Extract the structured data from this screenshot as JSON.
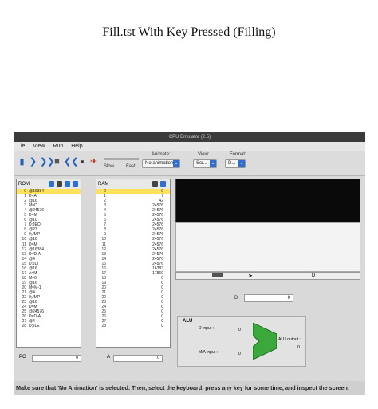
{
  "page": {
    "title": "Fill.tst With Key Pressed (Filling)"
  },
  "window": {
    "title": "CPU Emulator (2.5)"
  },
  "menu": [
    "le",
    "View",
    "Run",
    "Help"
  ],
  "toolbar": {
    "slow_label": "Slow",
    "fast_label": "Fast",
    "animate_label": "Animate:",
    "animate_value": "No animation",
    "view_label": "View:",
    "view_value": "Scr...",
    "format_label": "Format:",
    "format_value": "D..."
  },
  "rom": {
    "title": "ROM",
    "rows": [
      {
        "a": "0",
        "v": "@16384"
      },
      {
        "a": "1",
        "v": "D=A"
      },
      {
        "a": "2",
        "v": "@16"
      },
      {
        "a": "3",
        "v": "M=D"
      },
      {
        "a": "4",
        "v": "@24576"
      },
      {
        "a": "5",
        "v": "D=M"
      },
      {
        "a": "6",
        "v": "@10"
      },
      {
        "a": "7",
        "v": "D;JEQ"
      },
      {
        "a": "8",
        "v": "@23"
      },
      {
        "a": "9",
        "v": "0;JMP"
      },
      {
        "a": "10",
        "v": "@16"
      },
      {
        "a": "11",
        "v": "D=M"
      },
      {
        "a": "12",
        "v": "@16384"
      },
      {
        "a": "13",
        "v": "D=D-A"
      },
      {
        "a": "14",
        "v": "@4"
      },
      {
        "a": "15",
        "v": "D;JLT"
      },
      {
        "a": "16",
        "v": "@16"
      },
      {
        "a": "17",
        "v": "A=M"
      },
      {
        "a": "18",
        "v": "M=0"
      },
      {
        "a": "19",
        "v": "@16"
      },
      {
        "a": "20",
        "v": "M=M-1"
      },
      {
        "a": "21",
        "v": "@4"
      },
      {
        "a": "22",
        "v": "0;JMP"
      },
      {
        "a": "23",
        "v": "@16"
      },
      {
        "a": "24",
        "v": "D=M"
      },
      {
        "a": "25",
        "v": "@24576"
      },
      {
        "a": "26",
        "v": "D=D-A"
      },
      {
        "a": "27",
        "v": "@4"
      },
      {
        "a": "28",
        "v": "D;JLE"
      }
    ],
    "pc_label": "PC",
    "pc_value": "0"
  },
  "ram": {
    "title": "RAM",
    "rows": [
      {
        "a": "0",
        "v": "0"
      },
      {
        "a": "1",
        "v": "7"
      },
      {
        "a": "2",
        "v": "42"
      },
      {
        "a": "3",
        "v": "24576"
      },
      {
        "a": "4",
        "v": "24576"
      },
      {
        "a": "5",
        "v": "24576"
      },
      {
        "a": "6",
        "v": "24576"
      },
      {
        "a": "7",
        "v": "24576"
      },
      {
        "a": "8",
        "v": "24576"
      },
      {
        "a": "9",
        "v": "24576"
      },
      {
        "a": "10",
        "v": "24576"
      },
      {
        "a": "11",
        "v": "24576"
      },
      {
        "a": "12",
        "v": "24576"
      },
      {
        "a": "13",
        "v": "24576"
      },
      {
        "a": "14",
        "v": "24576"
      },
      {
        "a": "15",
        "v": "24576"
      },
      {
        "a": "16",
        "v": "16383"
      },
      {
        "a": "17",
        "v": "17860"
      },
      {
        "a": "18",
        "v": "0"
      },
      {
        "a": "19",
        "v": "0"
      },
      {
        "a": "20",
        "v": "0"
      },
      {
        "a": "21",
        "v": "0"
      },
      {
        "a": "22",
        "v": "0"
      },
      {
        "a": "23",
        "v": "0"
      },
      {
        "a": "24",
        "v": "0"
      },
      {
        "a": "25",
        "v": "0"
      },
      {
        "a": "26",
        "v": "0"
      },
      {
        "a": "27",
        "v": "0"
      },
      {
        "a": "28",
        "v": "0"
      }
    ],
    "a_label": "A",
    "a_value": "0"
  },
  "keyboard": {
    "key_value": "D"
  },
  "registers": {
    "d_label": "D",
    "d_value": "0"
  },
  "alu": {
    "title": "ALU",
    "d_input_label": "D Input :",
    "d_input_value": "0",
    "ma_input_label": "M/A Input :",
    "ma_input_value": "0",
    "output_label": "ALU output :",
    "output_value": "0"
  },
  "banner": "Make sure that 'No Animation' is selected. Then, select the keyboard, press any key for some time, and inspect the screen.",
  "colors": {
    "accent": "#2f6fd1",
    "highlight": "#ffe15a",
    "alu_green": "#3aa83a"
  }
}
